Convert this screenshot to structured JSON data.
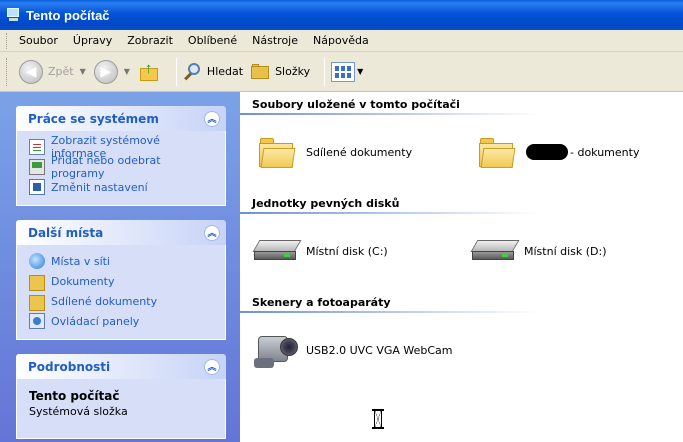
{
  "window": {
    "title": "Tento počítač"
  },
  "menu": [
    "Soubor",
    "Úpravy",
    "Zobrazit",
    "Oblíbené",
    "Nástroje",
    "Nápověda"
  ],
  "toolbar": {
    "back_label": "Zpět",
    "search_label": "Hledat",
    "folders_label": "Složky"
  },
  "left": {
    "tasks": {
      "title": "Práce se systémem",
      "links": [
        "Zobrazit systémové informace",
        "Přidat nebo odebrat programy",
        "Změnit nastavení"
      ]
    },
    "places": {
      "title": "Další místa",
      "links": [
        "Místa v síti",
        "Dokumenty",
        "Sdílené dokumenty",
        "Ovládací panely"
      ]
    },
    "details": {
      "title": "Podrobnosti",
      "name": "Tento počítač",
      "desc": "Systémová složka"
    }
  },
  "main": {
    "groups": {
      "stored": "Soubory uložené v tomto počítači",
      "drives": "Jednotky pevných disků",
      "scanners": "Skenery a fotoaparáty"
    },
    "shared_docs": "Sdílené dokumenty",
    "user_docs_suffix": "- dokumenty",
    "drive_c": "Místní disk (C:)",
    "drive_d": "Místní disk (D:)",
    "webcam": "USB2.0 UVC VGA WebCam"
  }
}
